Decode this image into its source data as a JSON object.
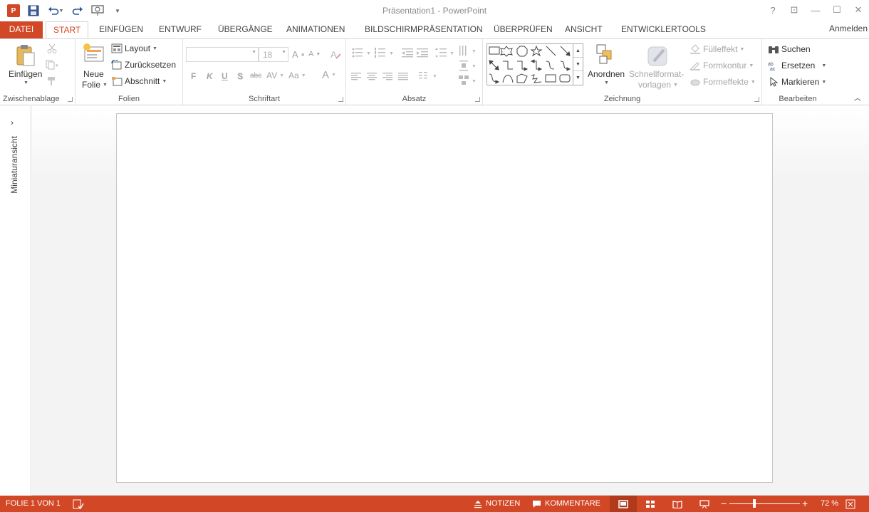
{
  "app": {
    "title": "Präsentation1 - PowerPoint",
    "logo_letter": "P",
    "sign_in": "Anmelden"
  },
  "window_controls": {
    "help": "?",
    "ribbon_display": "⊡",
    "minimize": "—",
    "maximize": "☐",
    "close": "✕"
  },
  "tabs": [
    {
      "label": "DATEI"
    },
    {
      "label": "START"
    },
    {
      "label": "EINFÜGEN"
    },
    {
      "label": "ENTWURF"
    },
    {
      "label": "ÜBERGÄNGE"
    },
    {
      "label": "ANIMATIONEN"
    },
    {
      "label": "BILDSCHIRMPRÄSENTATION"
    },
    {
      "label": "ÜBERPRÜFEN"
    },
    {
      "label": "ANSICHT"
    },
    {
      "label": "ENTWICKLERTOOLS"
    }
  ],
  "ribbon": {
    "clipboard": {
      "label": "Zwischenablage",
      "paste": "Einfügen"
    },
    "slides": {
      "label": "Folien",
      "new_slide_1": "Neue",
      "new_slide_2": "Folie",
      "layout": "Layout",
      "reset": "Zurücksetzen",
      "section": "Abschnitt"
    },
    "font": {
      "label": "Schriftart",
      "font_name": "",
      "font_size": "18",
      "bold": "F",
      "italic": "K",
      "underline": "U",
      "shadow": "S",
      "strike": "abc"
    },
    "paragraph": {
      "label": "Absatz"
    },
    "drawing": {
      "label": "Zeichnung",
      "arrange": "Anordnen",
      "quick_styles_1": "Schnellformat-",
      "quick_styles_2": "vorlagen",
      "fill": "Fülleffekt",
      "outline": "Formkontur",
      "effects": "Formeffekte"
    },
    "editing": {
      "label": "Bearbeiten",
      "find": "Suchen",
      "replace": "Ersetzen",
      "select": "Markieren"
    }
  },
  "thumbnail_pane": {
    "label": "Miniaturansicht"
  },
  "status": {
    "slide_info": "FOLIE 1 VON 1",
    "notes": "NOTIZEN",
    "comments": "KOMMENTARE",
    "zoom": "72 %",
    "zoom_minus": "−",
    "zoom_plus": "+",
    "zoom_level_percent": 72
  },
  "colors": {
    "accent": "#D24726",
    "accent_dark": "#B13A1D"
  }
}
